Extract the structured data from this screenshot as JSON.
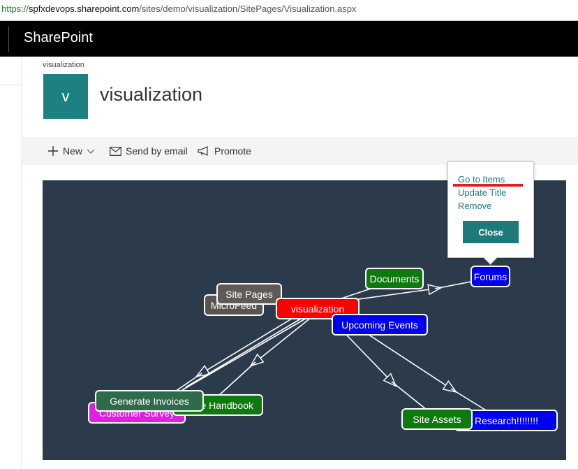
{
  "browser": {
    "url_scheme": "https://",
    "url_host": "spfxdevops.sharepoint.com",
    "url_path": "/sites/demo/visualization/SitePages/Visualization.aspx"
  },
  "suitebar": {
    "brand": "SharePoint"
  },
  "site": {
    "breadcrumb": "visualization",
    "logo_letter": "v",
    "logo_color": "#1e8080",
    "title": "visualization"
  },
  "commandbar": {
    "new_label": "New",
    "send_label": "Send by email",
    "promote_label": "Promote"
  },
  "graph": {
    "background": "#2c3b4c",
    "nodes": [
      {
        "id": "microfeed",
        "label": "MicroFeed",
        "color": "#5a5450"
      },
      {
        "id": "site-pages",
        "label": "Site Pages",
        "color": "#5f5a58"
      },
      {
        "id": "visualization",
        "label": "visualization",
        "color": "#ff0000"
      },
      {
        "id": "documents",
        "label": "Documents",
        "color": "#0e7a0e"
      },
      {
        "id": "forums",
        "label": "Forums",
        "color": "#0000ee"
      },
      {
        "id": "upcoming-events",
        "label": "Upcoming Events",
        "color": "#0000ee"
      },
      {
        "id": "customer-survey",
        "label": "Customer Survey",
        "color": "#e020e0"
      },
      {
        "id": "handbook",
        "label": "e Handbook",
        "color": "#0e7a0e"
      },
      {
        "id": "generate-invoices",
        "label": "Generate Invoices",
        "color": "#2e6b4a"
      },
      {
        "id": "research",
        "label": "Research!!!!!!!!",
        "color": "#0000ee"
      },
      {
        "id": "site-assets",
        "label": "Site Assets",
        "color": "#0e7a0e"
      }
    ]
  },
  "popup": {
    "go_to_items": "Go to Items",
    "update_title": "Update Title",
    "remove": "Remove",
    "close": "Close"
  }
}
